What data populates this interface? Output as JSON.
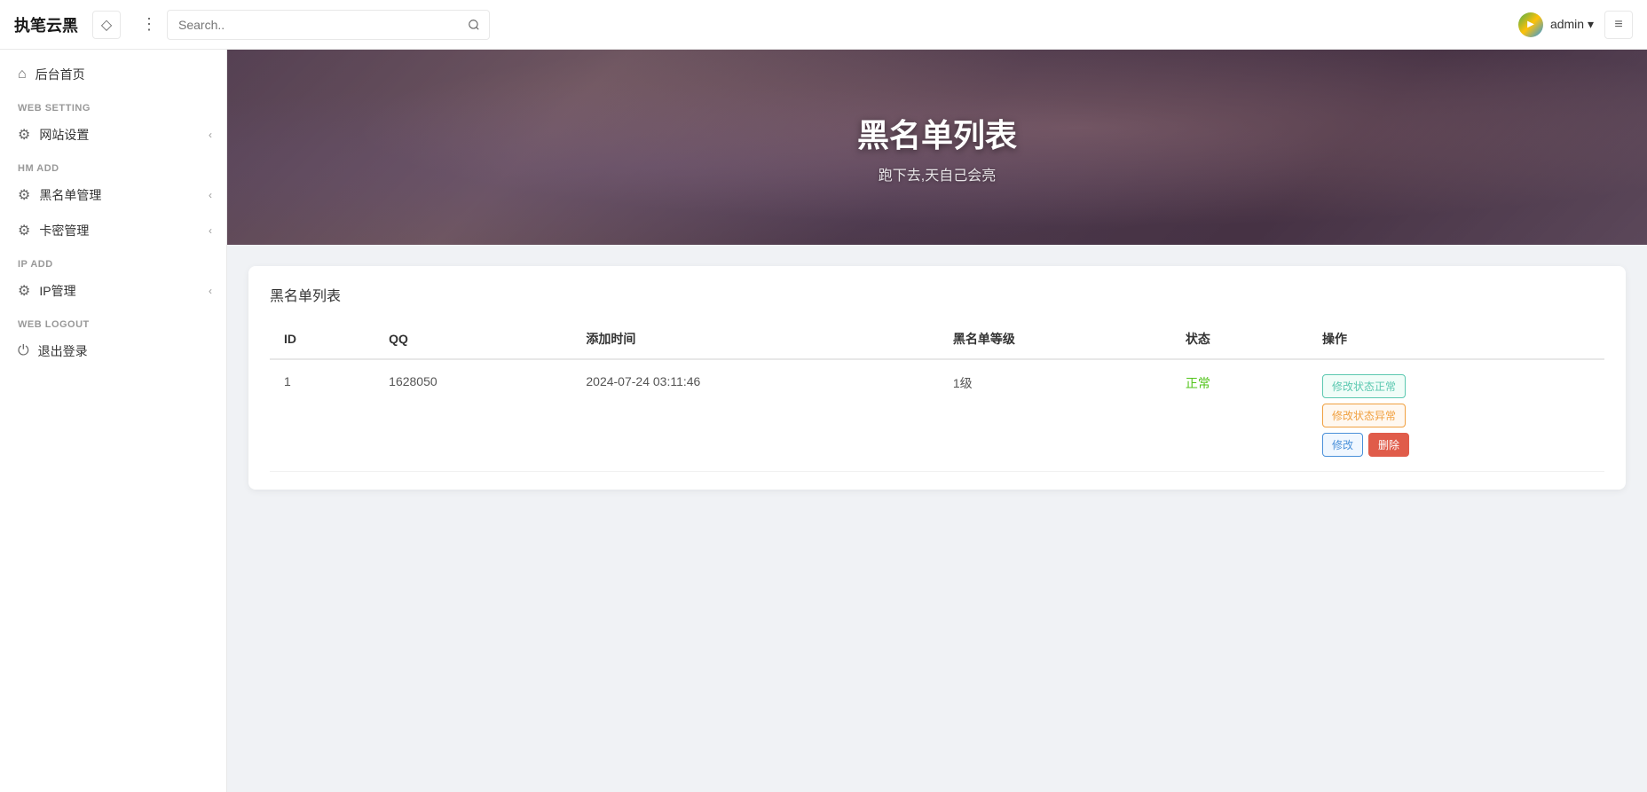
{
  "app": {
    "logo": "执笔云黑",
    "search_placeholder": "Search..",
    "user": {
      "name": "admin",
      "dropdown_label": "admin ▾"
    }
  },
  "sidebar": {
    "sections": [
      {
        "label": "",
        "items": [
          {
            "id": "home",
            "icon": "⌂",
            "label": "后台首页",
            "arrow": false
          }
        ]
      },
      {
        "label": "WEB SETTING",
        "items": [
          {
            "id": "website-settings",
            "icon": "⚙",
            "label": "网站设置",
            "arrow": true
          }
        ]
      },
      {
        "label": "HM ADD",
        "items": [
          {
            "id": "blacklist-manage",
            "icon": "⚙",
            "label": "黑名单管理",
            "arrow": true
          },
          {
            "id": "cardkey-manage",
            "icon": "⚙",
            "label": "卡密管理",
            "arrow": true
          }
        ]
      },
      {
        "label": "IP ADD",
        "items": [
          {
            "id": "ip-manage",
            "icon": "⚙",
            "label": "IP管理",
            "arrow": true
          }
        ]
      },
      {
        "label": "WEB LOGOUT",
        "items": [
          {
            "id": "logout",
            "icon": "⏻",
            "label": "退出登录",
            "arrow": false
          }
        ]
      }
    ]
  },
  "banner": {
    "title": "黑名单列表",
    "subtitle": "跑下去,天自己会亮"
  },
  "table": {
    "card_title": "黑名单列表",
    "columns": [
      "ID",
      "QQ",
      "添加时间",
      "黑名单等级",
      "状态",
      "操作"
    ],
    "rows": [
      {
        "id": "1",
        "qq": "1628050",
        "add_time": "2024-07-24 03:11:46",
        "level": "1级",
        "status": "正常",
        "actions": {
          "btn1": "修改状态正常",
          "btn2": "修改状态异常",
          "btn3": "修改",
          "btn4": "删除"
        }
      }
    ]
  }
}
